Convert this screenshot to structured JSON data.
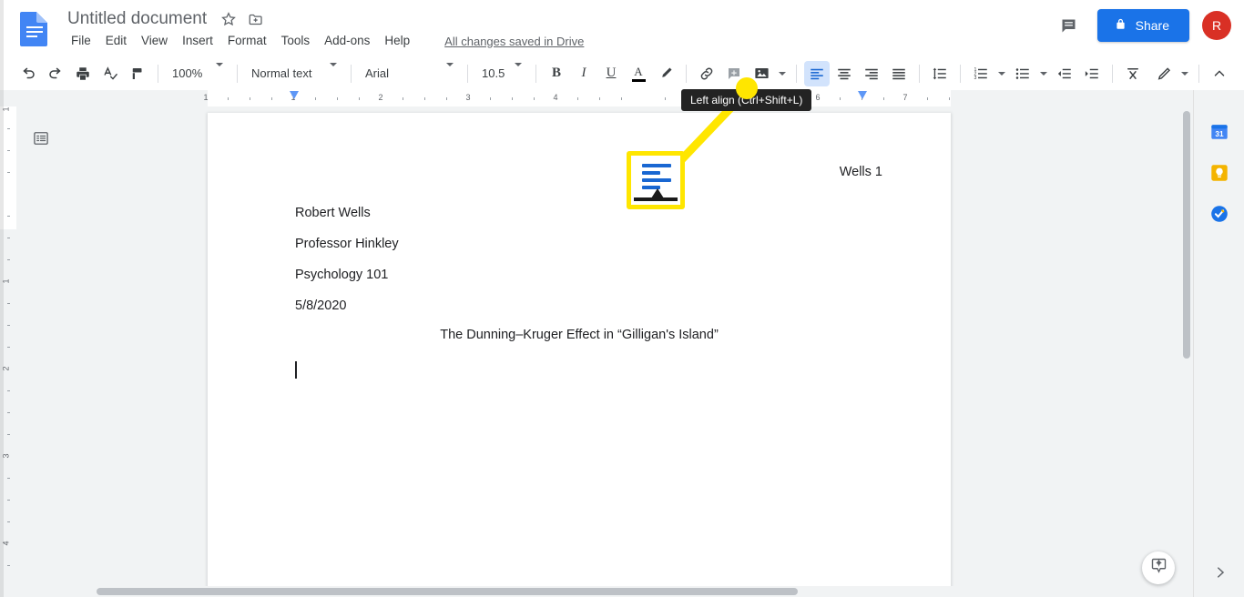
{
  "app": {
    "name": "Google Docs",
    "logo_icon": "docs-file-icon"
  },
  "header": {
    "doc_title": "Untitled document",
    "star_icon": "star-outline-icon",
    "move_icon": "move-to-folder-icon",
    "menus": [
      "File",
      "Edit",
      "View",
      "Insert",
      "Format",
      "Tools",
      "Add-ons",
      "Help"
    ],
    "save_status": "All changes saved in Drive",
    "comment_icon": "comment-history-icon",
    "share": {
      "label": "Share",
      "icon": "lock-icon",
      "color": "#1a73e8"
    },
    "avatar": {
      "initial": "R",
      "color": "#d93025"
    }
  },
  "toolbar": {
    "undo_icon": "undo-icon",
    "redo_icon": "redo-icon",
    "print_icon": "print-icon",
    "spelling_icon": "spellcheck-icon",
    "paint_format_icon": "paint-format-icon",
    "zoom": {
      "value": "100%",
      "name": "zoom-level"
    },
    "paragraph_style": {
      "value": "Normal text"
    },
    "font": {
      "value": "Arial"
    },
    "font_size": {
      "value": "10.5"
    },
    "bold_label": "B",
    "italic_label": "I",
    "underline_label": "U",
    "text_color_label": "A",
    "highlight_icon": "highlight-pen-icon",
    "link_icon": "insert-link-icon",
    "comment_icon": "add-comment-icon",
    "image_icon": "insert-image-icon",
    "align_left_icon": "align-left-icon",
    "align_center_icon": "align-center-icon",
    "align_right_icon": "align-right-icon",
    "align_justify_icon": "align-justify-icon",
    "line_spacing_icon": "line-spacing-icon",
    "numbered_list_icon": "numbered-list-icon",
    "bulleted_list_icon": "bulleted-list-icon",
    "decrease_indent_icon": "decrease-indent-icon",
    "increase_indent_icon": "increase-indent-icon",
    "clear_formatting_icon": "clear-formatting-icon",
    "editing_mode_icon": "editing-pencil-icon",
    "collapse_icon": "collapse-toolbar-icon",
    "active_button": "align-left",
    "active_color": "#d2e3fc"
  },
  "ruler": {
    "horizontal_numbers": [
      "1",
      "1",
      "2",
      "3",
      "4",
      "6",
      "7"
    ],
    "vertical_numbers": [
      "1",
      "1",
      "2",
      "3",
      "4"
    ],
    "left_indent_marker": "indent-marker",
    "right_indent_marker": "indent-marker"
  },
  "document": {
    "outline_icon": "document-outline-icon",
    "header_text": "Wells 1",
    "lines": [
      "Robert Wells",
      "Professor Hinkley",
      "Psychology 101",
      "5/8/2020"
    ],
    "title_line": "The Dunning–Kruger Effect in “Gilligan's Island”",
    "cursor": "text-caret"
  },
  "side_rail": {
    "calendar": {
      "icon": "google-calendar-icon",
      "label": "31"
    },
    "keep": {
      "icon": "google-keep-icon"
    },
    "tasks": {
      "icon": "google-tasks-icon"
    },
    "expand_icon": "chevron-right-icon"
  },
  "explore": {
    "icon": "explore-star-icon"
  },
  "annotation": {
    "tooltip_text": "Left align (Ctrl+Shift+L)",
    "highlight_color": "#ffe600",
    "callout_icon": "align-left-magnified-icon"
  }
}
